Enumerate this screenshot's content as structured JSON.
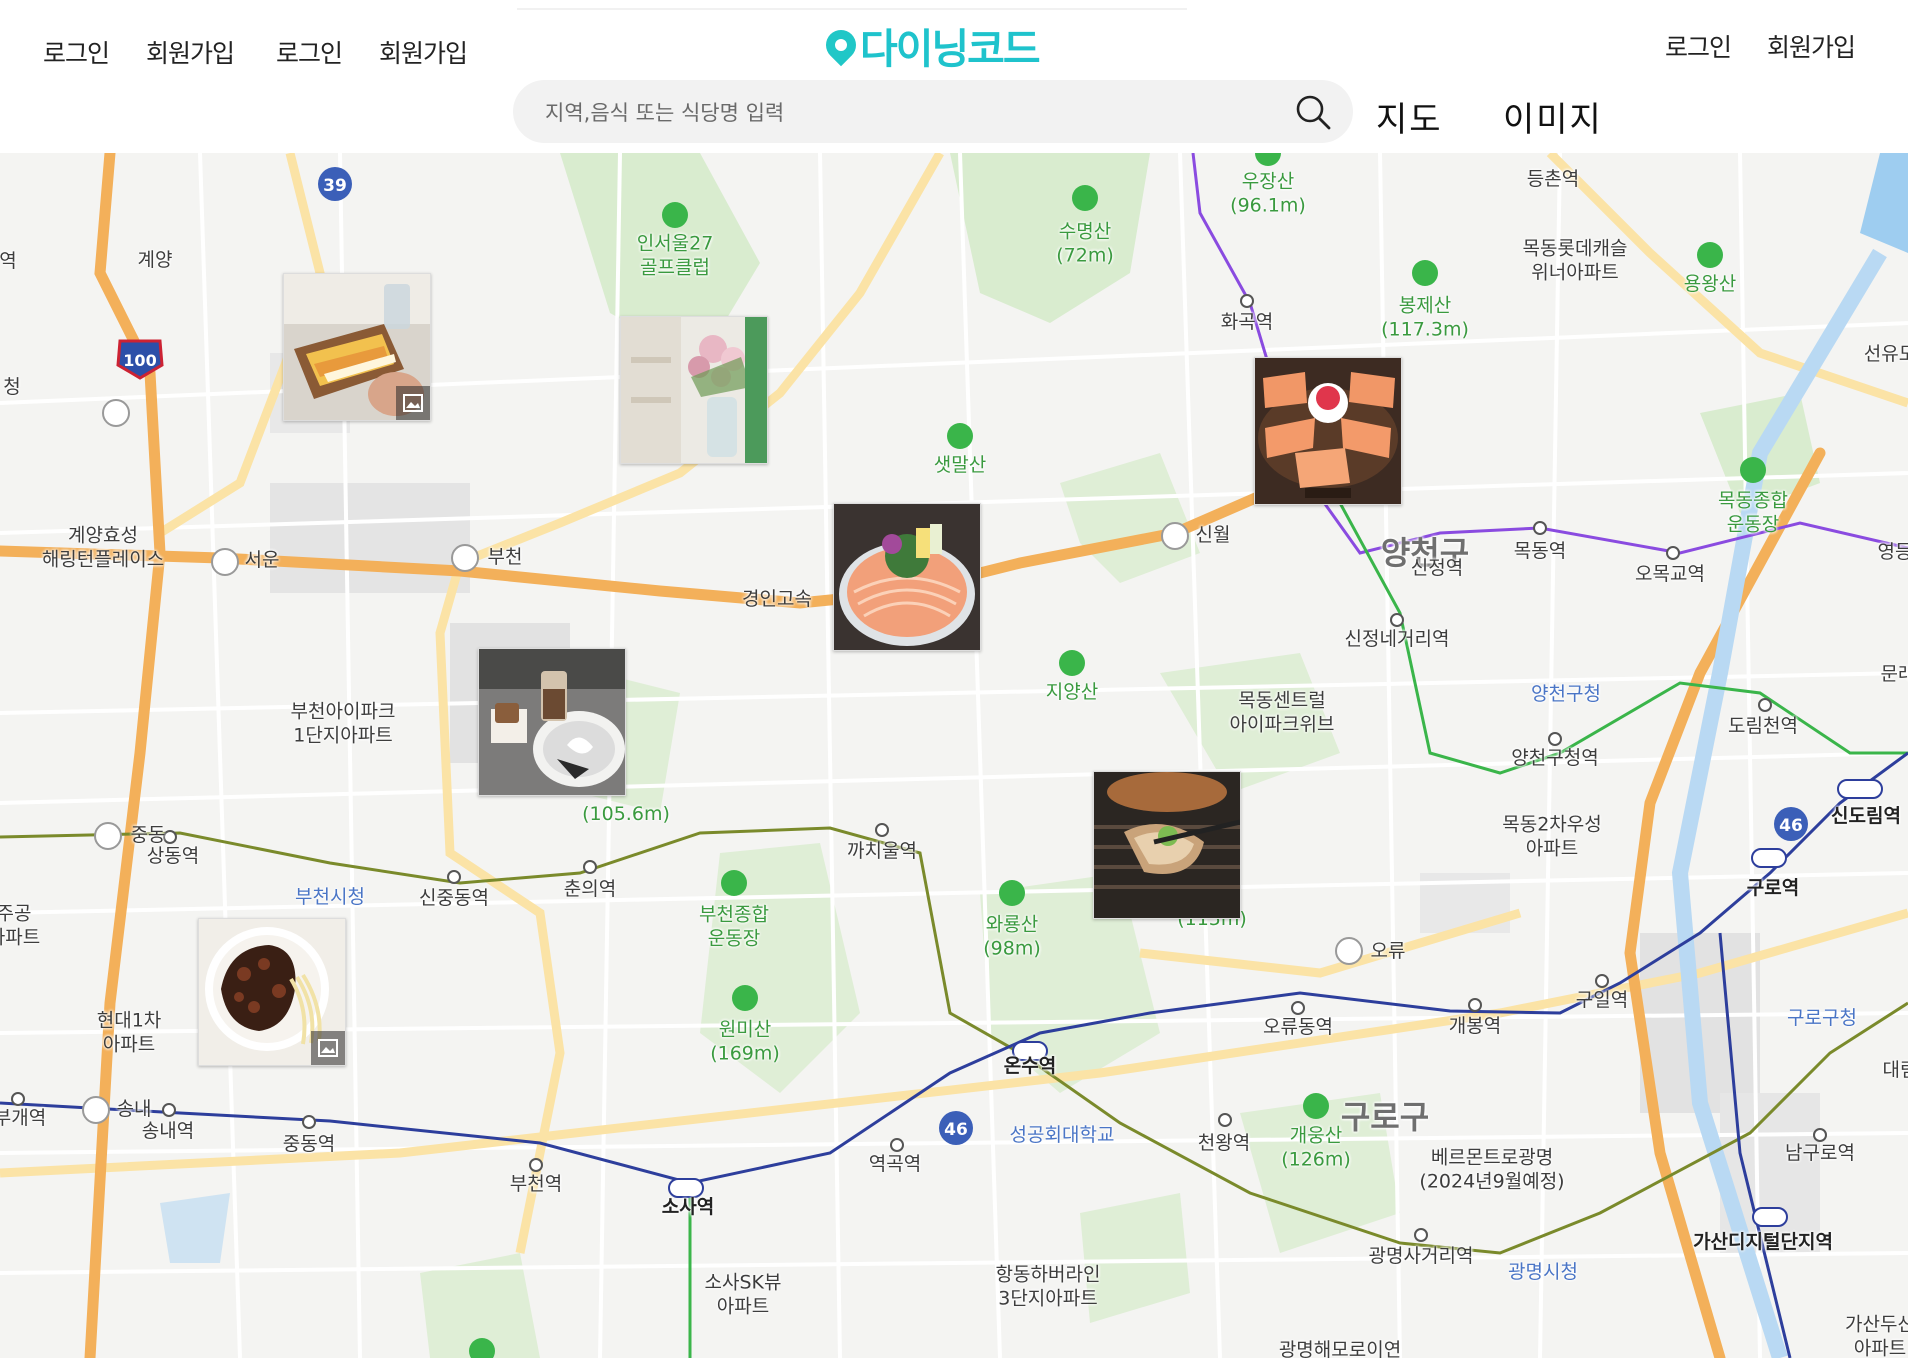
{
  "header": {
    "left_links": [
      "로그인",
      "회원가입",
      "로그인",
      "회원가입"
    ],
    "right_links": [
      "로그인",
      "회원가입"
    ],
    "logo_text": "다이닝코드",
    "search_placeholder": "지역,음식 또는 식당명 입력",
    "tabs": [
      "지도",
      "이미지"
    ]
  },
  "colors": {
    "brand": "#1fc3cc",
    "line_purple": "#8a4be0",
    "line_green": "#3ab54a",
    "line_olive": "#7a8a2b",
    "line_navy": "#2d3e9c",
    "expressway": "#f3b05a"
  },
  "map": {
    "labels": [
      {
        "text": "계양",
        "kind": "ic"
      },
      {
        "text": "계양효성\n해링턴플레이스",
        "kind": "poi"
      },
      {
        "text": "서운",
        "kind": "jc"
      },
      {
        "text": "부천",
        "kind": "ic"
      },
      {
        "text": "경인고속",
        "kind": "road"
      },
      {
        "text": "부천아이파크\n1단지아파트",
        "kind": "poi"
      },
      {
        "text": "인서울27\n골프클럽",
        "kind": "park"
      },
      {
        "text": "수명산\n(72m)",
        "kind": "mountain"
      },
      {
        "text": "우장산\n(96.1m)",
        "kind": "mountain"
      },
      {
        "text": "봉제산\n(117.3m)",
        "kind": "mountain"
      },
      {
        "text": "등촌역",
        "kind": "station"
      },
      {
        "text": "목동롯데캐슬\n위너아파트",
        "kind": "poi"
      },
      {
        "text": "용왕산",
        "kind": "mountain"
      },
      {
        "text": "선유도",
        "kind": "station"
      },
      {
        "text": "화곡역",
        "kind": "station"
      },
      {
        "text": "샛말산",
        "kind": "mountain"
      },
      {
        "text": "신월",
        "kind": "ic"
      },
      {
        "text": "목동종합\n운동장",
        "kind": "park"
      },
      {
        "text": "양천구",
        "kind": "district"
      },
      {
        "text": "신정역",
        "kind": "station"
      },
      {
        "text": "목동역",
        "kind": "station"
      },
      {
        "text": "오목교역",
        "kind": "station"
      },
      {
        "text": "영등",
        "kind": "station"
      },
      {
        "text": "신정네거리역",
        "kind": "station"
      },
      {
        "text": "지양산",
        "kind": "mountain"
      },
      {
        "text": "목동센트럴\n아이파크위브",
        "kind": "poi"
      },
      {
        "text": "양천구청",
        "kind": "gov"
      },
      {
        "text": "양천구청역",
        "kind": "station"
      },
      {
        "text": "도림천역",
        "kind": "station"
      },
      {
        "text": "문래",
        "kind": "station"
      },
      {
        "text": "신도림역",
        "kind": "station"
      },
      {
        "text": "목동2차우성\n아파트",
        "kind": "poi"
      },
      {
        "text": "구로역",
        "kind": "station"
      },
      {
        "text": "(105.6m)",
        "kind": "mountain"
      },
      {
        "text": "중동",
        "kind": "ic"
      },
      {
        "text": "상동역",
        "kind": "station"
      },
      {
        "text": "부천시청",
        "kind": "gov"
      },
      {
        "text": "신중동역",
        "kind": "station"
      },
      {
        "text": "춘의역",
        "kind": "station"
      },
      {
        "text": "까치울역",
        "kind": "station"
      },
      {
        "text": "부천종합\n운동장",
        "kind": "park"
      },
      {
        "text": "와룡산\n(98m)",
        "kind": "mountain"
      },
      {
        "text": "(115m)",
        "kind": "mountain"
      },
      {
        "text": "오류",
        "kind": "ic"
      },
      {
        "text": "주공\n아파트",
        "kind": "poi"
      },
      {
        "text": "현대1차\n아파트",
        "kind": "poi"
      },
      {
        "text": "원미산\n(169m)",
        "kind": "mountain"
      },
      {
        "text": "오류동역",
        "kind": "station"
      },
      {
        "text": "개봉역",
        "kind": "station"
      },
      {
        "text": "구일역",
        "kind": "station"
      },
      {
        "text": "구로구청",
        "kind": "gov"
      },
      {
        "text": "대림",
        "kind": "station"
      },
      {
        "text": "온수역",
        "kind": "station"
      },
      {
        "text": "송내",
        "kind": "ic"
      },
      {
        "text": "송내역",
        "kind": "station"
      },
      {
        "text": "부개역",
        "kind": "station"
      },
      {
        "text": "중동역",
        "kind": "station"
      },
      {
        "text": "부천역",
        "kind": "station"
      },
      {
        "text": "소사역",
        "kind": "station"
      },
      {
        "text": "역곡역",
        "kind": "station"
      },
      {
        "text": "성공회대학교",
        "kind": "school"
      },
      {
        "text": "천왕역",
        "kind": "station"
      },
      {
        "text": "개웅산\n(126m)",
        "kind": "mountain"
      },
      {
        "text": "구로구",
        "kind": "district"
      },
      {
        "text": "베르몬트로광명\n(2024년9월예정)",
        "kind": "poi"
      },
      {
        "text": "남구로역",
        "kind": "station"
      },
      {
        "text": "가산디지털단지역",
        "kind": "station"
      },
      {
        "text": "광명사거리역",
        "kind": "station"
      },
      {
        "text": "광명시청",
        "kind": "gov"
      },
      {
        "text": "소사SK뷰\n아파트",
        "kind": "poi"
      },
      {
        "text": "항동하버라인\n3단지아파트",
        "kind": "poi"
      },
      {
        "text": "가산두산\n아파트",
        "kind": "poi"
      },
      {
        "text": "광명해모로이연",
        "kind": "poi"
      },
      {
        "text": "청",
        "kind": "poi"
      },
      {
        "text": "역",
        "kind": "station"
      }
    ],
    "route_badges": [
      "39",
      "100",
      "46",
      "46"
    ],
    "photo_markers": [
      {
        "name": "sandwich",
        "has_gallery_icon": true
      },
      {
        "name": "flowers-cafe",
        "has_gallery_icon": false
      },
      {
        "name": "salmon-sushi",
        "has_gallery_icon": false
      },
      {
        "name": "raw-fish-platter",
        "has_gallery_icon": false
      },
      {
        "name": "cafe-dessert",
        "has_gallery_icon": false
      },
      {
        "name": "grilled-pork",
        "has_gallery_icon": false
      },
      {
        "name": "jjajangmyeon",
        "has_gallery_icon": true
      }
    ]
  }
}
